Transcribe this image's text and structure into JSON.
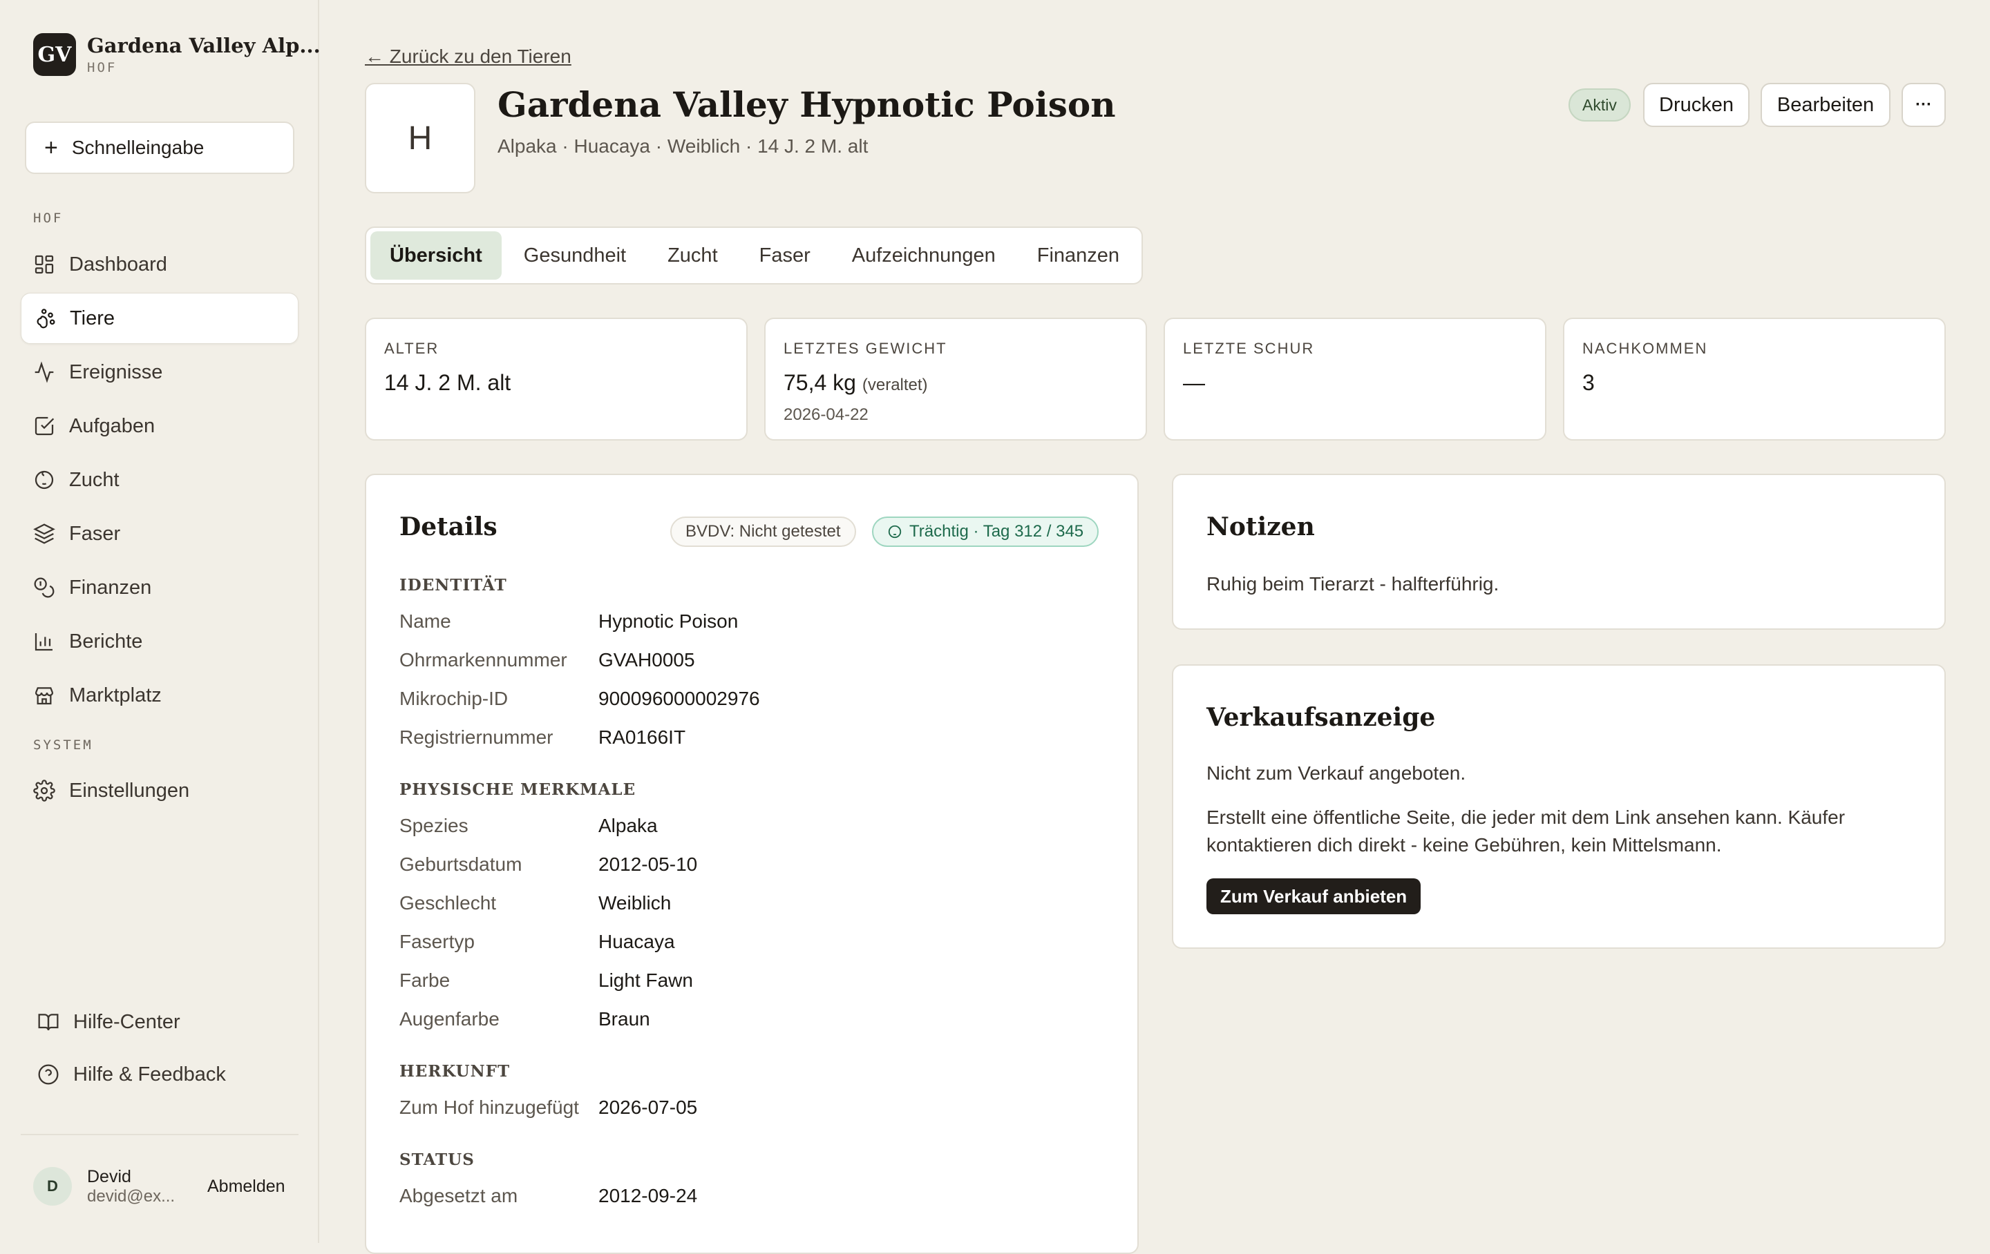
{
  "brand": {
    "initials": "GV",
    "name": "Gardena Valley Alp...",
    "sub": "HOF"
  },
  "sidebar": {
    "quick_label": "Schnelleingabe",
    "section_farm": "HOF",
    "section_system": "SYSTEM",
    "items": [
      {
        "label": "Dashboard",
        "icon": "dashboard-icon"
      },
      {
        "label": "Tiere",
        "icon": "paw-icon",
        "active": true
      },
      {
        "label": "Ereignisse",
        "icon": "activity-icon"
      },
      {
        "label": "Aufgaben",
        "icon": "checkbox-icon"
      },
      {
        "label": "Zucht",
        "icon": "baby-icon"
      },
      {
        "label": "Faser",
        "icon": "layers-icon"
      },
      {
        "label": "Finanzen",
        "icon": "coins-icon"
      },
      {
        "label": "Berichte",
        "icon": "bar-chart-icon"
      },
      {
        "label": "Marktplatz",
        "icon": "store-icon"
      }
    ],
    "settings_label": "Einstellungen",
    "help_center": "Hilfe-Center",
    "help_feedback": "Hilfe & Feedback",
    "user": {
      "initial": "D",
      "name": "Devid",
      "email": "devid@ex...",
      "logout": "Abmelden"
    }
  },
  "header": {
    "back_link": "← Zurück zu den Tieren",
    "avatar_letter": "H",
    "title": "Gardena Valley Hypnotic Poison",
    "subtitle": "Alpaka · Huacaya · Weiblich · 14 J. 2 M. alt",
    "status_badge": "Aktiv",
    "print_label": "Drucken",
    "edit_label": "Bearbeiten",
    "more_label": "···"
  },
  "tabs": [
    "Übersicht",
    "Gesundheit",
    "Zucht",
    "Faser",
    "Aufzeichnungen",
    "Finanzen"
  ],
  "stats": {
    "age": {
      "label": "ALTER",
      "value": "14 J. 2 M. alt"
    },
    "weight": {
      "label": "LETZTES GEWICHT",
      "value": "75,4 kg",
      "note": "(veraltet)",
      "date": "2026-04-22"
    },
    "shear": {
      "label": "LETZTE SCHUR",
      "value": "—"
    },
    "offspring": {
      "label": "NACHKOMMEN",
      "value": "3"
    }
  },
  "details": {
    "title": "Details",
    "bvdv_pill": "BVDV: Nicht getestet",
    "pregnant_pill": "Trächtig · Tag 312 / 345",
    "identity_label": "IDENTITÄT",
    "identity": [
      {
        "k": "Name",
        "v": "Hypnotic Poison"
      },
      {
        "k": "Ohrmarkennummer",
        "v": "GVAH0005"
      },
      {
        "k": "Mikrochip-ID",
        "v": "900096000002976"
      },
      {
        "k": "Registriernummer",
        "v": "RA0166IT"
      }
    ],
    "physical_label": "PHYSISCHE MERKMALE",
    "physical": [
      {
        "k": "Spezies",
        "v": "Alpaka"
      },
      {
        "k": "Geburtsdatum",
        "v": "2012-05-10"
      },
      {
        "k": "Geschlecht",
        "v": "Weiblich"
      },
      {
        "k": "Fasertyp",
        "v": "Huacaya"
      },
      {
        "k": "Farbe",
        "v": "Light Fawn"
      },
      {
        "k": "Augenfarbe",
        "v": "Braun"
      }
    ],
    "origin_label": "HERKUNFT",
    "origin": [
      {
        "k": "Zum Hof hinzugefügt",
        "v": "2026-07-05"
      }
    ],
    "status_label": "STATUS",
    "status": [
      {
        "k": "Abgesetzt am",
        "v": "2012-09-24"
      }
    ]
  },
  "notes": {
    "title": "Notizen",
    "text": "Ruhig beim Tierarzt - halfterführig."
  },
  "sale": {
    "title": "Verkaufsanzeige",
    "status": "Nicht zum Verkauf angeboten.",
    "description": "Erstellt eine öffentliche Seite, die jeder mit dem Link ansehen kann. Käufer kontaktieren dich direkt - keine Gebühren, kein Mittelsmann.",
    "button": "Zum Verkauf anbieten"
  }
}
